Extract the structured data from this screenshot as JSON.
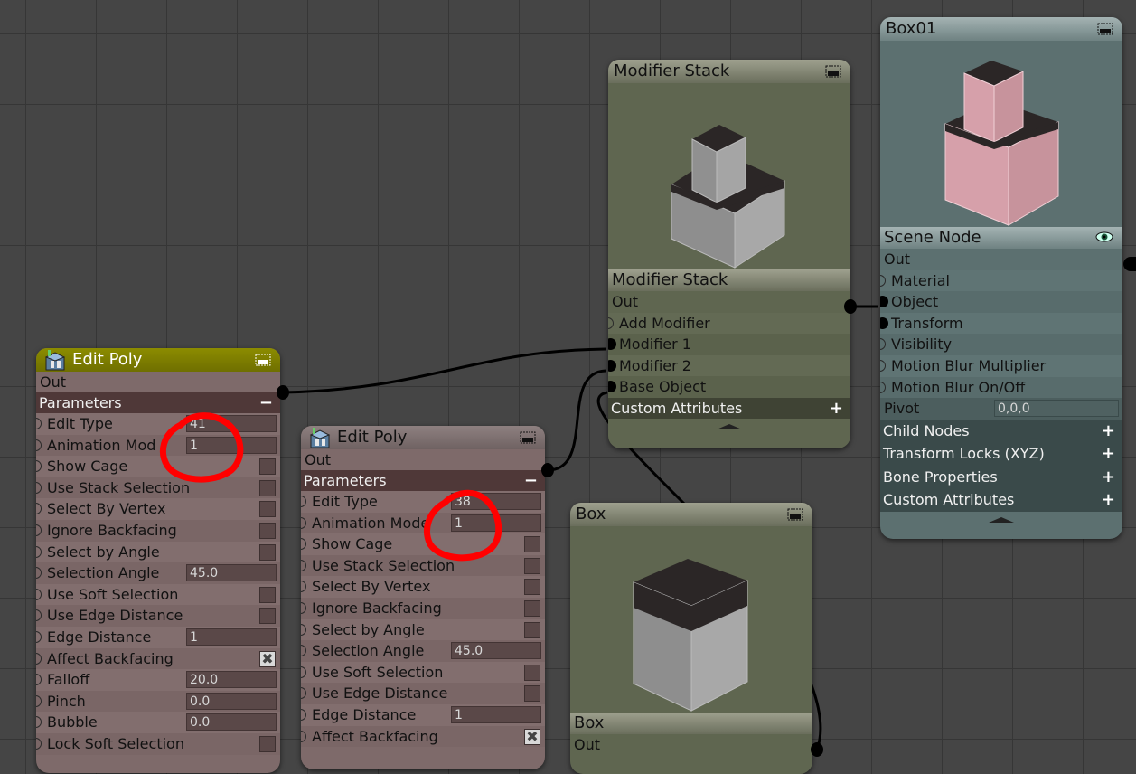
{
  "editPoly1": {
    "title": "Edit Poly",
    "out": "Out",
    "section": "Parameters",
    "section_toggle": "−",
    "rows": [
      {
        "label": "Edit Type",
        "value": "41"
      },
      {
        "label": "Animation Mod",
        "value": "1"
      },
      {
        "label": "Show Cage"
      },
      {
        "label": "Use Stack Selection"
      },
      {
        "label": "Select By Vertex"
      },
      {
        "label": "Ignore Backfacing"
      },
      {
        "label": "Select by Angle"
      },
      {
        "label": "Selection Angle",
        "value": "45.0"
      },
      {
        "label": "Use Soft Selection"
      },
      {
        "label": "Use Edge Distance"
      },
      {
        "label": "Edge Distance",
        "value": "1"
      },
      {
        "label": "Affect Backfacing",
        "checked_mark": "✖"
      },
      {
        "label": "Falloff",
        "value": "20.0"
      },
      {
        "label": "Pinch",
        "value": "0.0"
      },
      {
        "label": "Bubble",
        "value": "0.0"
      },
      {
        "label": "Lock Soft Selection"
      }
    ]
  },
  "editPoly2": {
    "title": "Edit Poly",
    "out": "Out",
    "section": "Parameters",
    "section_toggle": "−",
    "rows": [
      {
        "label": "Edit Type",
        "value": "38"
      },
      {
        "label": "Animation Mode",
        "value": "1"
      },
      {
        "label": "Show Cage"
      },
      {
        "label": "Use Stack Selection"
      },
      {
        "label": "Select By Vertex"
      },
      {
        "label": "Ignore Backfacing"
      },
      {
        "label": "Select by Angle"
      },
      {
        "label": "Selection Angle",
        "value": "45.0"
      },
      {
        "label": "Use Soft Selection"
      },
      {
        "label": "Use Edge Distance"
      },
      {
        "label": "Edge Distance",
        "value": "1"
      },
      {
        "label": "Affect Backfacing",
        "checked_mark": "✖"
      }
    ]
  },
  "modifierStack": {
    "title": "Modifier Stack",
    "subtitle": "Modifier Stack",
    "out": "Out",
    "inputs": [
      "Add Modifier",
      "Modifier 1",
      "Modifier 2",
      "Base Object"
    ],
    "section": "Custom Attributes",
    "section_toggle": "+"
  },
  "box": {
    "title": "Box",
    "subtitle": "Box",
    "out": "Out"
  },
  "box01": {
    "title": "Box01",
    "subtitle": "Scene Node",
    "out": "Out",
    "inputs": [
      "Material",
      "Object",
      "Transform",
      "Visibility",
      "Motion Blur Multiplier",
      "Motion Blur On/Off"
    ],
    "pivot_label": "Pivot",
    "pivot_value": "0,0,0",
    "sections": [
      "Child Nodes",
      "Transform Locks (XYZ)",
      "Bone Properties",
      "Custom Attributes"
    ],
    "section_toggle": "+"
  },
  "icons": [
    "edit-poly-icon",
    "node-menu-icon",
    "eye-icon"
  ],
  "colors": {
    "editpoly_title": "#7d7d00",
    "editpoly_body": "#806a6a",
    "modstack_body": "#5f6650",
    "box01_body": "#5c7070",
    "annotation": "#ff0000"
  }
}
